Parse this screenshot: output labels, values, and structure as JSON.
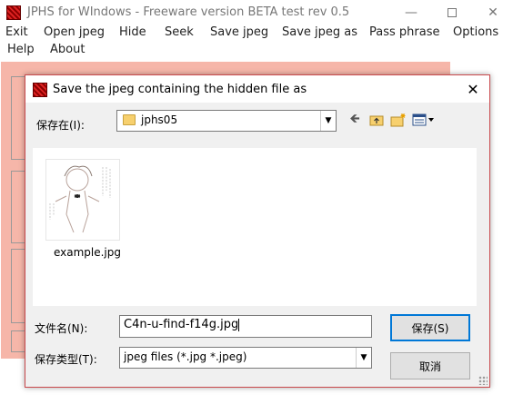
{
  "main_window": {
    "title": "JPHS for WIndows - Freeware version BETA test rev 0.5",
    "menu": [
      "Exit",
      "Open jpeg",
      "Hide",
      "Seek",
      "Save jpeg",
      "Save jpeg as",
      "Pass phrase",
      "Options",
      "Help",
      "About"
    ]
  },
  "dialog": {
    "title": "Save the jpeg containing the hidden file as",
    "save_in_label": "保存在(I):",
    "folder": "jphs05",
    "files": [
      {
        "name": "example.jpg"
      }
    ],
    "filename_label": "文件名(N):",
    "filename_value": "C4n-u-find-f14g.jpg",
    "filetype_label": "保存类型(T):",
    "filetype_value": "jpeg files (*.jpg *.jpeg)",
    "save_button": "保存(S)",
    "cancel_button": "取消"
  },
  "colors": {
    "accent": "#0078d7",
    "dialog_border": "#c9494d",
    "app_panel": "#f6b6a9"
  }
}
